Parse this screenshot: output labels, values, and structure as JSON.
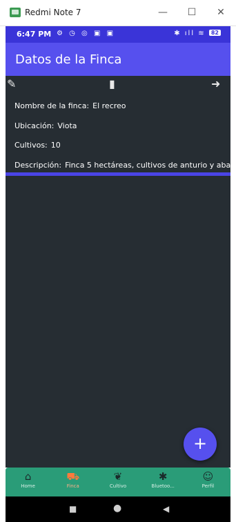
{
  "window": {
    "title": "Redmi Note 7",
    "minimize": "—",
    "maximize": "☐",
    "close": "✕"
  },
  "status_bar": {
    "time": "6:47 PM",
    "left_icons": "⚙ ◷ ◎ ▣ ▣",
    "right_icons": "✱ ıll ≋",
    "battery": "82"
  },
  "app_bar": {
    "title": "Datos de la Finca"
  },
  "toolbar": {
    "edit_icon": "✎",
    "delete_icon": "▮",
    "move_icon": "➜"
  },
  "details": {
    "name_label": "Nombre de la finca:",
    "name_value": "El recreo",
    "location_label": "Ubicación:",
    "location_value": "Viota",
    "crops_label": "Cultivos:",
    "crops_value": "10",
    "description_label": "Descripción:",
    "description_value": "Finca 5 hectáreas, cultivos de anturio y aba"
  },
  "fab": {
    "label": "+"
  },
  "bottom_nav": {
    "items": [
      {
        "icon": "⌂",
        "label": "Home"
      },
      {
        "icon": "⛟",
        "label": "Finca"
      },
      {
        "icon": "❦",
        "label": "Cultivo"
      },
      {
        "icon": "✱",
        "label": "Bluetoo..."
      },
      {
        "icon": "☺",
        "label": "Perfil"
      }
    ],
    "active_index": 1,
    "colors": {
      "background": "#2a9c78",
      "active": "#ff7a3c"
    }
  },
  "system_nav": {
    "recents": "■",
    "home": "●",
    "back": "◀"
  },
  "colors": {
    "primary": "#5650ee",
    "status_bar": "#3a34d8",
    "background": "#262d33"
  }
}
